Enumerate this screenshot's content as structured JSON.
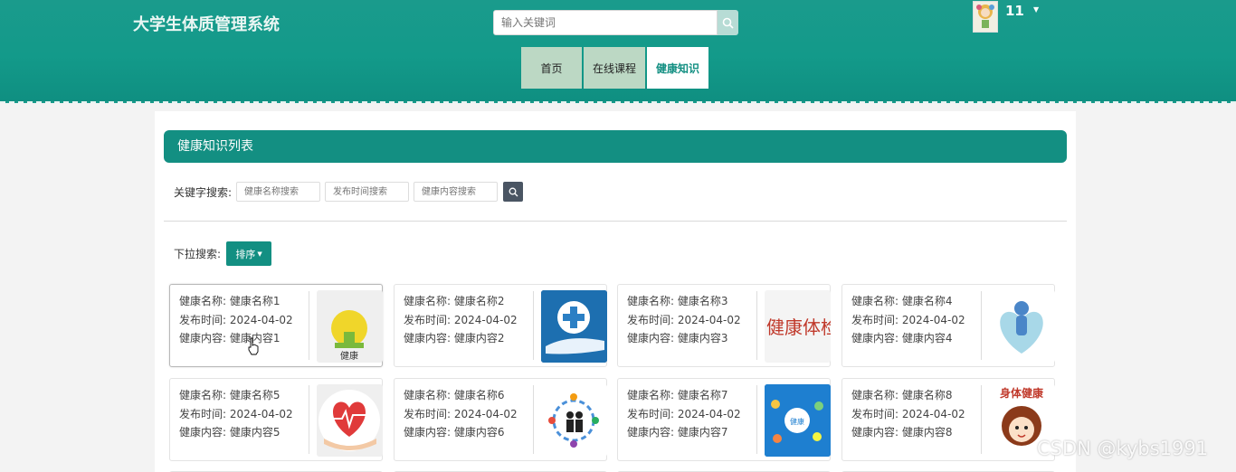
{
  "header": {
    "brand": "大学生体质管理系统",
    "search_placeholder": "输入关键词",
    "username": "11"
  },
  "nav": [
    {
      "label": "首页"
    },
    {
      "label": "在线课程"
    },
    {
      "label": "健康知识"
    }
  ],
  "main": {
    "title": "健康知识列表",
    "keyword_label": "关键字搜索:",
    "placeholders": {
      "name": "健康名称搜索",
      "time": "发布时间搜索",
      "content": "健康内容搜索"
    },
    "dropdown_label": "下拉搜索:",
    "sort_label": "排序"
  },
  "cards": [
    {
      "name": "健康名称: 健康名称1",
      "time": "发布时间: 2024-04-02",
      "content": "健康内容: 健康内容1",
      "thumb_text": "健康"
    },
    {
      "name": "健康名称: 健康名称2",
      "time": "发布时间: 2024-04-02",
      "content": "健康内容: 健康内容2",
      "thumb_text": ""
    },
    {
      "name": "健康名称: 健康名称3",
      "time": "发布时间: 2024-04-02",
      "content": "健康内容: 健康内容3",
      "thumb_text": "健康体检"
    },
    {
      "name": "健康名称: 健康名称4",
      "time": "发布时间: 2024-04-02",
      "content": "健康内容: 健康内容4",
      "thumb_text": ""
    },
    {
      "name": "健康名称: 健康名称5",
      "time": "发布时间: 2024-04-02",
      "content": "健康内容: 健康内容5",
      "thumb_text": ""
    },
    {
      "name": "健康名称: 健康名称6",
      "time": "发布时间: 2024-04-02",
      "content": "健康内容: 健康内容6",
      "thumb_text": ""
    },
    {
      "name": "健康名称: 健康名称7",
      "time": "发布时间: 2024-04-02",
      "content": "健康内容: 健康内容7",
      "thumb_text": "健康"
    },
    {
      "name": "健康名称: 健康名称8",
      "time": "发布时间: 2024-04-02",
      "content": "健康内容: 健康内容8",
      "thumb_text": "身体健康"
    }
  ],
  "watermark": "CSDN @kybs1991",
  "colors": {
    "primary": "#138f82",
    "nav_inactive": "#bcd8c4"
  }
}
